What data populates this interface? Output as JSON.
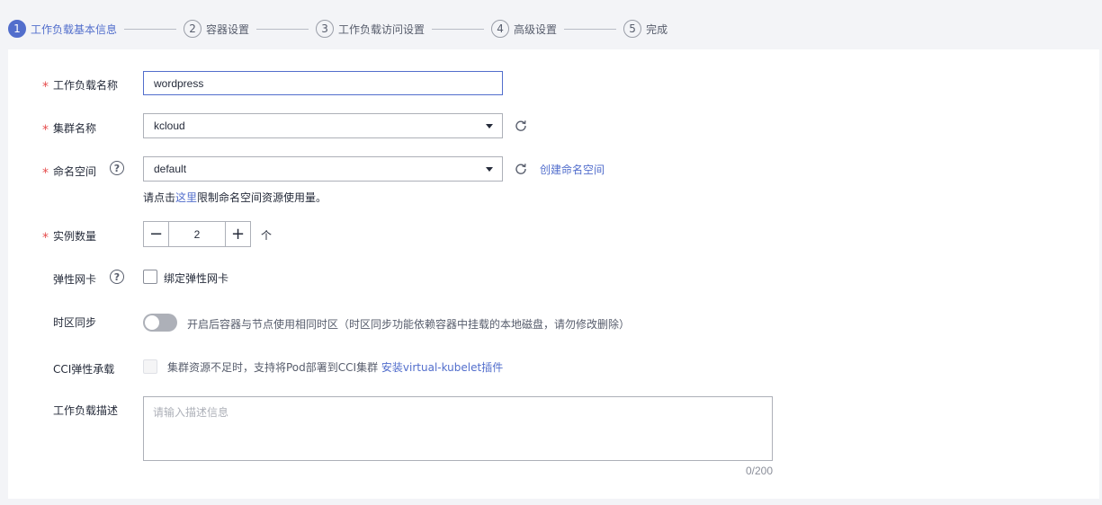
{
  "steps": [
    {
      "num": "1",
      "label": "工作负载基本信息"
    },
    {
      "num": "2",
      "label": "容器设置"
    },
    {
      "num": "3",
      "label": "工作负载访问设置"
    },
    {
      "num": "4",
      "label": "高级设置"
    },
    {
      "num": "5",
      "label": "完成"
    }
  ],
  "form": {
    "required_mark": "*",
    "workload_name": {
      "label": "工作负载名称",
      "value": "wordpress"
    },
    "cluster": {
      "label": "集群名称",
      "value": "kcloud"
    },
    "namespace": {
      "label": "命名空间",
      "value": "default",
      "create_link": "创建命名空间",
      "tip_prefix": "请点击",
      "tip_link": "这里",
      "tip_suffix": "限制命名空间资源使用量。"
    },
    "instances": {
      "label": "实例数量",
      "value": "2",
      "unit": "个",
      "minus": "−",
      "plus": "+"
    },
    "eni": {
      "label": "弹性网卡",
      "checkbox_label": "绑定弹性网卡",
      "checked": false
    },
    "timezone": {
      "label": "时区同步",
      "hint": "开启后容器与节点使用相同时区（时区同步功能依赖容器中挂载的本地磁盘，请勿修改删除）",
      "enabled": false
    },
    "cci": {
      "label": "CCI弹性承载",
      "hint": "集群资源不足时，支持将Pod部署到CCI集群",
      "link": "安装virtual-kubelet插件",
      "disabled": true
    },
    "description": {
      "label": "工作负载描述",
      "placeholder": "请输入描述信息",
      "counter": "0/200"
    }
  },
  "icons": {
    "help": "?",
    "help_icon": "help-circle-icon",
    "refresh_icon": "refresh-icon",
    "caret_icon": "chevron-down-icon"
  },
  "colors": {
    "accent": "#526ecc",
    "required": "#e64d4d",
    "border": "#adb0b8"
  }
}
